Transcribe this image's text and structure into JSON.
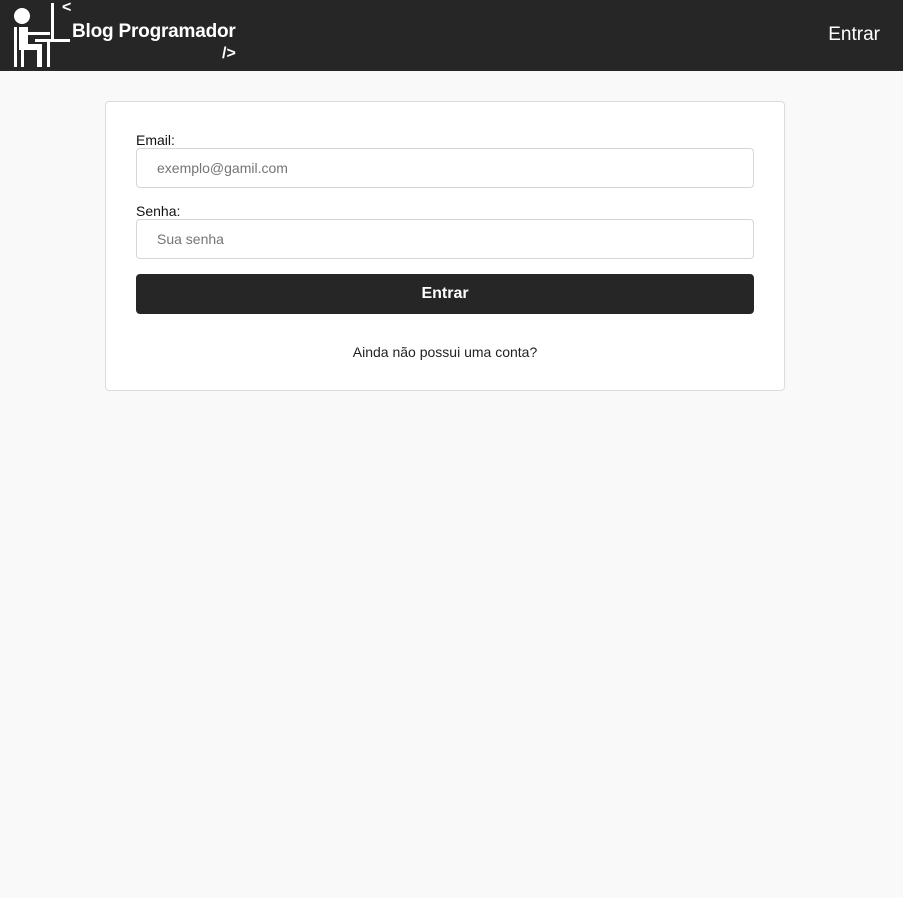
{
  "header": {
    "brand_open_tag": "<",
    "brand_name": "Blog Programador",
    "brand_close_tag": "/>",
    "nav_login": "Entrar"
  },
  "login_form": {
    "email_label": "Email:",
    "email_placeholder": "exemplo@gamil.com",
    "email_value": "",
    "password_label": "Senha:",
    "password_placeholder": "Sua senha",
    "password_value": "",
    "submit_label": "Entrar",
    "signup_link": "Ainda não possui uma conta?"
  },
  "icons": {
    "logo": "programmer-at-desk-icon"
  },
  "colors": {
    "header_bg": "#262626",
    "page_bg": "#f9f9f9",
    "button_bg": "#262626",
    "text_light": "#ffffff"
  }
}
